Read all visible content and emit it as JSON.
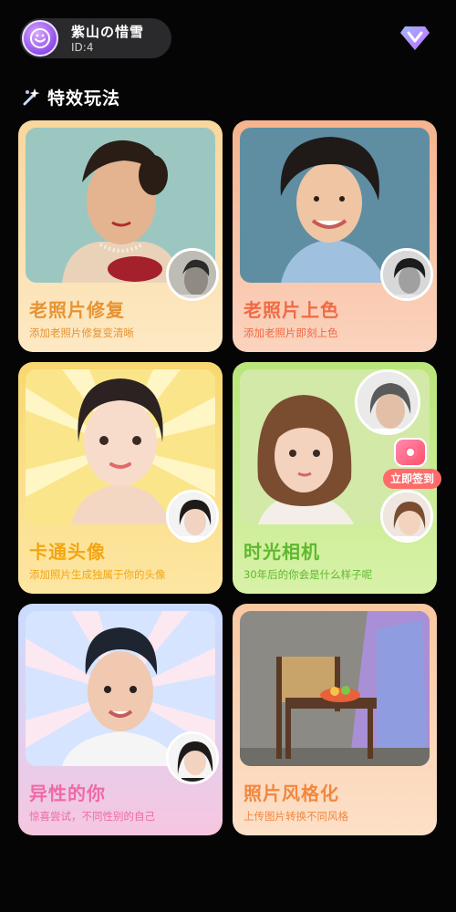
{
  "header": {
    "user_name": "紫山の惜雪",
    "user_id": "ID:4",
    "vip_icon": "diamond-v-icon"
  },
  "section": {
    "title": "特效玩法",
    "icon": "magic-wand-icon"
  },
  "cards": [
    {
      "title": "老照片修复",
      "desc": "添加老照片修复变清晰"
    },
    {
      "title": "老照片上色",
      "desc": "添加老照片即刻上色"
    },
    {
      "title": "卡通头像",
      "desc": "添加照片生成独属于你的头像"
    },
    {
      "title": "时光相机",
      "desc": "30年后的你会是什么样子呢"
    },
    {
      "title": "异性的你",
      "desc": "惊喜尝试，不同性别的自己"
    },
    {
      "title": "照片风格化",
      "desc": "上传图片转换不同风格"
    }
  ],
  "checkin": {
    "label": "立即签到"
  },
  "colors": {
    "background": "#050505",
    "restore": "#e69333",
    "colorize": "#f06a45",
    "cartoon": "#f3a613",
    "time": "#5fb82e",
    "gender": "#ef6aa6",
    "style": "#f1873e"
  }
}
